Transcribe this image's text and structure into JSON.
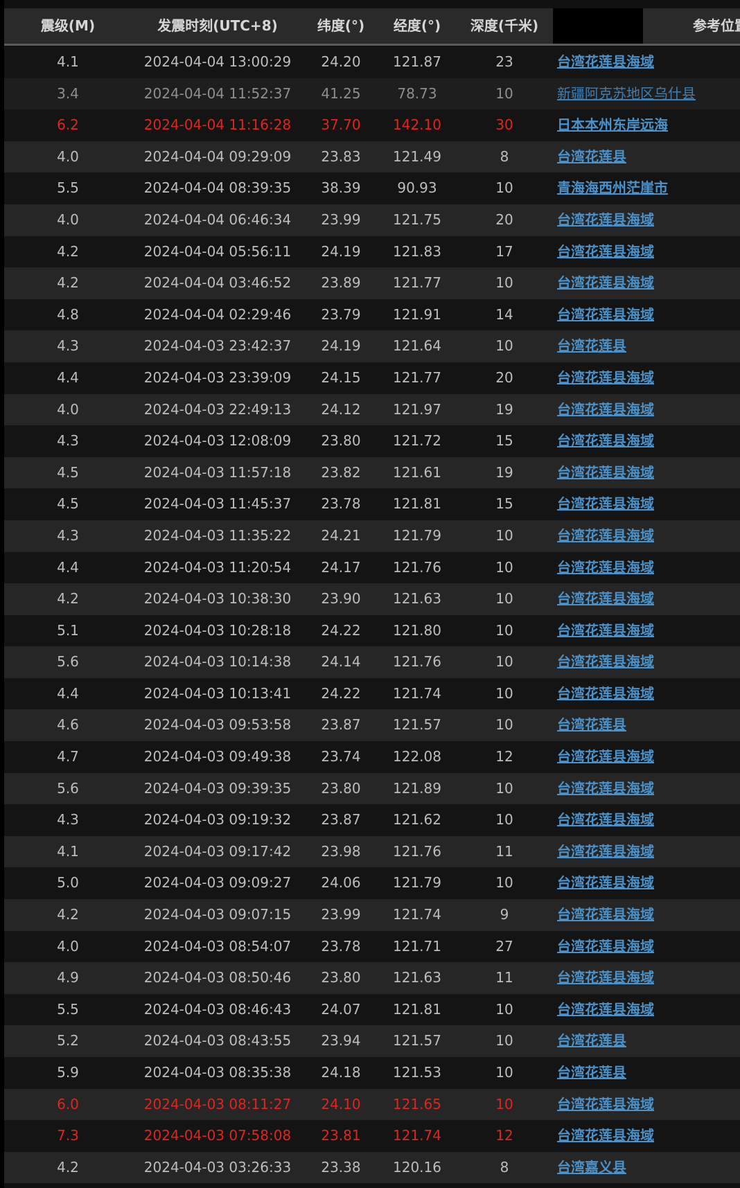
{
  "table": {
    "columns": [
      {
        "key": "mag",
        "label": "震级(M)"
      },
      {
        "key": "time",
        "label": "发震时刻(UTC+8)"
      },
      {
        "key": "lat",
        "label": "纬度(°)"
      },
      {
        "key": "lon",
        "label": "经度(°)"
      },
      {
        "key": "depth",
        "label": "深度(千米)"
      },
      {
        "key": "blank",
        "label": ""
      },
      {
        "key": "loc",
        "label": "参考位置"
      }
    ],
    "colors": {
      "normal_text": "#bdbdbd",
      "alert_text": "#e0251c",
      "link": "#4a92c9",
      "header_bg": "#2a2a2a",
      "row_dark": "#141414",
      "row_light": "#262626"
    },
    "rows": [
      {
        "mag": "4.1",
        "time": "2024-04-04 13:00:29",
        "lat": "24.20",
        "lon": "121.87",
        "depth": "23",
        "loc": "台湾花莲县海域",
        "style": "normal"
      },
      {
        "mag": "3.4",
        "time": "2024-04-04 11:52:37",
        "lat": "41.25",
        "lon": "78.73",
        "depth": "10",
        "loc": "新疆阿克苏地区乌什县",
        "style": "dim"
      },
      {
        "mag": "6.2",
        "time": "2024-04-04 11:16:28",
        "lat": "37.70",
        "lon": "142.10",
        "depth": "30",
        "loc": "日本本州东岸远海",
        "style": "alert"
      },
      {
        "mag": "4.0",
        "time": "2024-04-04 09:29:09",
        "lat": "23.83",
        "lon": "121.49",
        "depth": "8",
        "loc": "台湾花莲县",
        "style": "normal"
      },
      {
        "mag": "5.5",
        "time": "2024-04-04 08:39:35",
        "lat": "38.39",
        "lon": "90.93",
        "depth": "10",
        "loc": "青海海西州茫崖市",
        "style": "normal"
      },
      {
        "mag": "4.0",
        "time": "2024-04-04 06:46:34",
        "lat": "23.99",
        "lon": "121.75",
        "depth": "20",
        "loc": "台湾花莲县海域",
        "style": "normal"
      },
      {
        "mag": "4.2",
        "time": "2024-04-04 05:56:11",
        "lat": "24.19",
        "lon": "121.83",
        "depth": "17",
        "loc": "台湾花莲县海域",
        "style": "normal"
      },
      {
        "mag": "4.2",
        "time": "2024-04-04 03:46:52",
        "lat": "23.89",
        "lon": "121.77",
        "depth": "10",
        "loc": "台湾花莲县海域",
        "style": "normal"
      },
      {
        "mag": "4.8",
        "time": "2024-04-04 02:29:46",
        "lat": "23.79",
        "lon": "121.91",
        "depth": "14",
        "loc": "台湾花莲县海域",
        "style": "normal"
      },
      {
        "mag": "4.3",
        "time": "2024-04-03 23:42:37",
        "lat": "24.19",
        "lon": "121.64",
        "depth": "10",
        "loc": "台湾花莲县",
        "style": "normal"
      },
      {
        "mag": "4.4",
        "time": "2024-04-03 23:39:09",
        "lat": "24.15",
        "lon": "121.77",
        "depth": "20",
        "loc": "台湾花莲县海域",
        "style": "normal"
      },
      {
        "mag": "4.0",
        "time": "2024-04-03 22:49:13",
        "lat": "24.12",
        "lon": "121.97",
        "depth": "19",
        "loc": "台湾花莲县海域",
        "style": "normal"
      },
      {
        "mag": "4.3",
        "time": "2024-04-03 12:08:09",
        "lat": "23.80",
        "lon": "121.72",
        "depth": "15",
        "loc": "台湾花莲县海域",
        "style": "normal"
      },
      {
        "mag": "4.5",
        "time": "2024-04-03 11:57:18",
        "lat": "23.82",
        "lon": "121.61",
        "depth": "19",
        "loc": "台湾花莲县海域",
        "style": "normal"
      },
      {
        "mag": "4.5",
        "time": "2024-04-03 11:45:37",
        "lat": "23.78",
        "lon": "121.81",
        "depth": "15",
        "loc": "台湾花莲县海域",
        "style": "normal"
      },
      {
        "mag": "4.3",
        "time": "2024-04-03 11:35:22",
        "lat": "24.21",
        "lon": "121.79",
        "depth": "10",
        "loc": "台湾花莲县海域",
        "style": "normal"
      },
      {
        "mag": "4.4",
        "time": "2024-04-03 11:20:54",
        "lat": "24.17",
        "lon": "121.76",
        "depth": "10",
        "loc": "台湾花莲县海域",
        "style": "normal"
      },
      {
        "mag": "4.2",
        "time": "2024-04-03 10:38:30",
        "lat": "23.90",
        "lon": "121.63",
        "depth": "10",
        "loc": "台湾花莲县海域",
        "style": "normal"
      },
      {
        "mag": "5.1",
        "time": "2024-04-03 10:28:18",
        "lat": "24.22",
        "lon": "121.80",
        "depth": "10",
        "loc": "台湾花莲县海域",
        "style": "normal"
      },
      {
        "mag": "5.6",
        "time": "2024-04-03 10:14:38",
        "lat": "24.14",
        "lon": "121.76",
        "depth": "10",
        "loc": "台湾花莲县海域",
        "style": "normal"
      },
      {
        "mag": "4.4",
        "time": "2024-04-03 10:13:41",
        "lat": "24.22",
        "lon": "121.74",
        "depth": "10",
        "loc": "台湾花莲县海域",
        "style": "normal"
      },
      {
        "mag": "4.6",
        "time": "2024-04-03 09:53:58",
        "lat": "23.87",
        "lon": "121.57",
        "depth": "10",
        "loc": "台湾花莲县",
        "style": "normal"
      },
      {
        "mag": "4.7",
        "time": "2024-04-03 09:49:38",
        "lat": "23.74",
        "lon": "122.08",
        "depth": "12",
        "loc": "台湾花莲县海域",
        "style": "normal"
      },
      {
        "mag": "5.6",
        "time": "2024-04-03 09:39:35",
        "lat": "23.80",
        "lon": "121.89",
        "depth": "10",
        "loc": "台湾花莲县海域",
        "style": "normal"
      },
      {
        "mag": "4.3",
        "time": "2024-04-03 09:19:32",
        "lat": "23.87",
        "lon": "121.62",
        "depth": "10",
        "loc": "台湾花莲县海域",
        "style": "normal"
      },
      {
        "mag": "4.1",
        "time": "2024-04-03 09:17:42",
        "lat": "23.98",
        "lon": "121.76",
        "depth": "11",
        "loc": "台湾花莲县海域",
        "style": "normal"
      },
      {
        "mag": "5.0",
        "time": "2024-04-03 09:09:27",
        "lat": "24.06",
        "lon": "121.79",
        "depth": "10",
        "loc": "台湾花莲县海域",
        "style": "normal"
      },
      {
        "mag": "4.2",
        "time": "2024-04-03 09:07:15",
        "lat": "23.99",
        "lon": "121.74",
        "depth": "9",
        "loc": "台湾花莲县海域",
        "style": "normal"
      },
      {
        "mag": "4.0",
        "time": "2024-04-03 08:54:07",
        "lat": "23.78",
        "lon": "121.71",
        "depth": "27",
        "loc": "台湾花莲县海域",
        "style": "normal"
      },
      {
        "mag": "4.9",
        "time": "2024-04-03 08:50:46",
        "lat": "23.80",
        "lon": "121.63",
        "depth": "11",
        "loc": "台湾花莲县海域",
        "style": "normal"
      },
      {
        "mag": "5.5",
        "time": "2024-04-03 08:46:43",
        "lat": "24.07",
        "lon": "121.81",
        "depth": "10",
        "loc": "台湾花莲县海域",
        "style": "normal"
      },
      {
        "mag": "5.2",
        "time": "2024-04-03 08:43:55",
        "lat": "23.94",
        "lon": "121.57",
        "depth": "10",
        "loc": "台湾花莲县",
        "style": "normal"
      },
      {
        "mag": "5.9",
        "time": "2024-04-03 08:35:38",
        "lat": "24.18",
        "lon": "121.53",
        "depth": "10",
        "loc": "台湾花莲县",
        "style": "normal"
      },
      {
        "mag": "6.0",
        "time": "2024-04-03 08:11:27",
        "lat": "24.10",
        "lon": "121.65",
        "depth": "10",
        "loc": "台湾花莲县海域",
        "style": "alert"
      },
      {
        "mag": "7.3",
        "time": "2024-04-03 07:58:08",
        "lat": "23.81",
        "lon": "121.74",
        "depth": "12",
        "loc": "台湾花莲县海域",
        "style": "alert"
      },
      {
        "mag": "4.2",
        "time": "2024-04-03 03:26:33",
        "lat": "23.38",
        "lon": "120.16",
        "depth": "8",
        "loc": "台湾嘉义县",
        "style": "normal"
      }
    ]
  }
}
